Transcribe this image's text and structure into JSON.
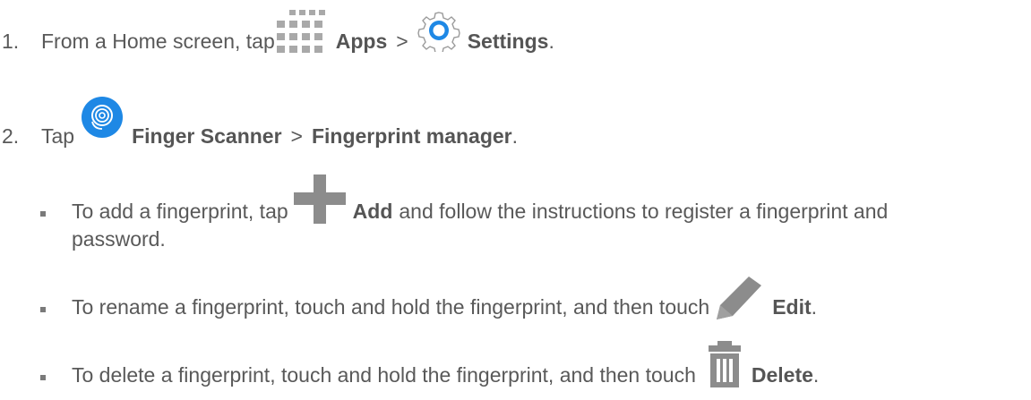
{
  "steps": [
    {
      "number": "1.",
      "text_a": "From a Home screen, tap",
      "icon_a": "apps-grid-icon",
      "label_a": "Apps",
      "sep": ">",
      "icon_b": "settings-gear-icon",
      "label_b": "Settings",
      "end": "."
    },
    {
      "number": "2.",
      "text_a": "Tap",
      "icon_a": "fingerprint-icon",
      "label_a": "Finger Scanner",
      "sep": ">",
      "label_b": "Fingerprint manager",
      "end": "."
    }
  ],
  "bullets": [
    {
      "text_a": "To add a fingerprint, tap",
      "icon": "plus-icon",
      "label": "Add",
      "text_b": "and follow the instructions to register a fingerprint and",
      "text_c": "password."
    },
    {
      "text_a": "To rename a fingerprint, touch and hold the fingerprint, and then touch",
      "icon": "pencil-icon",
      "label": "Edit",
      "end": "."
    },
    {
      "text_a": "To delete a fingerprint, touch and hold the fingerprint, and then touch",
      "icon": "trash-icon",
      "label": "Delete",
      "end": "."
    }
  ],
  "colors": {
    "text": "#595959",
    "icon_blue": "#1e88e5",
    "icon_gray": "#8c8c8c"
  }
}
